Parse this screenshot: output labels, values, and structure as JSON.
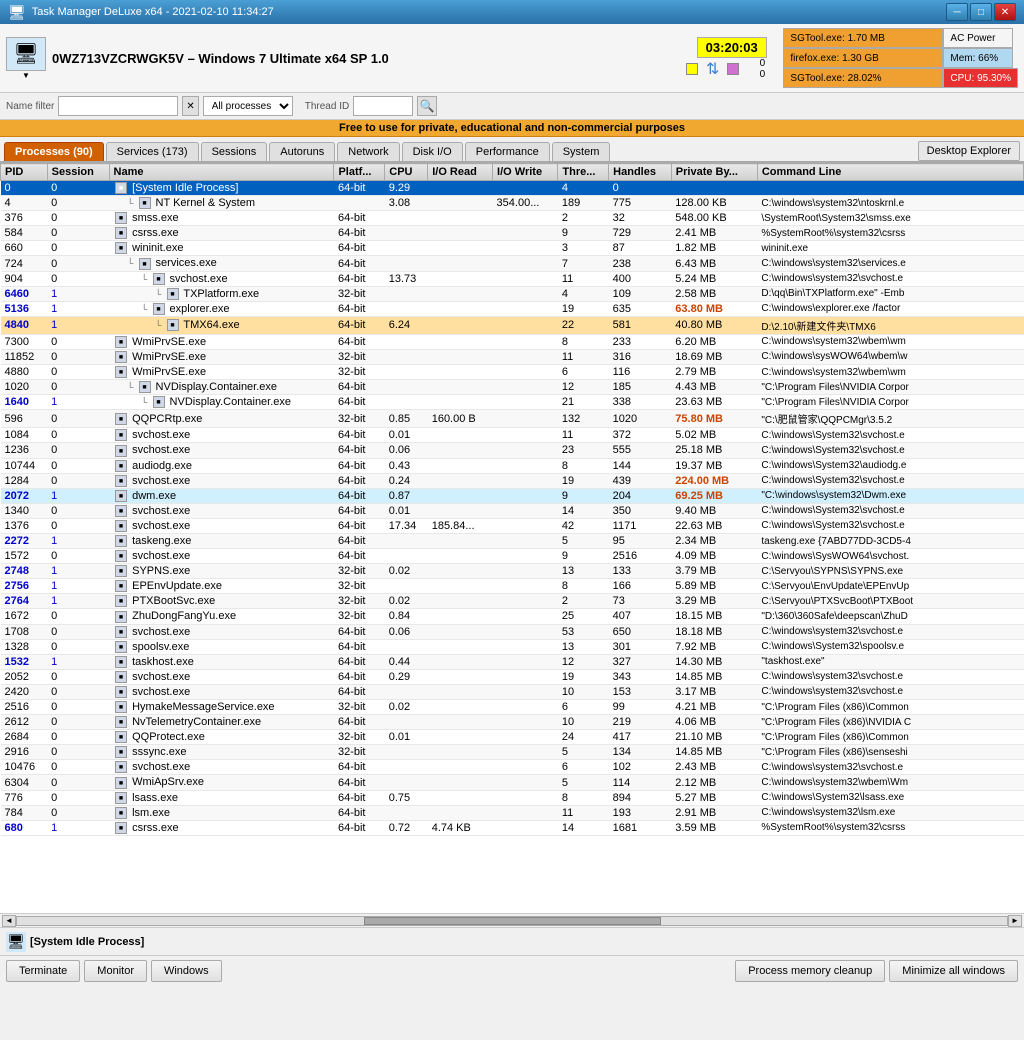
{
  "window": {
    "title": "Task Manager DeLuxe x64 - 2021-02-10 11:34:27",
    "icon": "🖥"
  },
  "header": {
    "machine_name": "0WZ713VZCRWGK5V – Windows 7 Ultimate x64 SP 1.0",
    "clock": "03:20:03",
    "ac_power": "AC Power",
    "mem_label": "Mem: 66%",
    "cpu_label": "CPU: 95.30%",
    "sgtool_mem": "SGTool.exe: 1.70 MB",
    "firefox_mem": "firefox.exe: 1.30 GB",
    "sgtool_cpu": "SGTool.exe: 28.02%"
  },
  "filterbar": {
    "name_filter_label": "Name filter",
    "name_filter_value": "",
    "process_dropdown": "All processes",
    "thread_id_label": "Thread ID",
    "thread_id_value": ""
  },
  "infobar": {
    "text": "Free to use for private, educational and non-commercial  purposes"
  },
  "tabs": {
    "items": [
      {
        "label": "Processes (90)",
        "active": true
      },
      {
        "label": "Services (173)",
        "active": false
      },
      {
        "label": "Sessions",
        "active": false
      },
      {
        "label": "Autoruns",
        "active": false
      },
      {
        "label": "Network",
        "active": false
      },
      {
        "label": "Disk I/O",
        "active": false
      },
      {
        "label": "Performance",
        "active": false
      },
      {
        "label": "System",
        "active": false
      }
    ],
    "desktop_explorer": "Desktop Explorer"
  },
  "table": {
    "columns": [
      "PID",
      "Session",
      "Name",
      "Platf...",
      "CPU",
      "I/O Read",
      "I/O Write",
      "Thre...",
      "Handles",
      "Private By...",
      "Command Line"
    ],
    "rows": [
      {
        "pid": "0",
        "session": "0",
        "name": "[System Idle Process]",
        "platform": "64-bit",
        "cpu": "9.29",
        "io_read": "",
        "io_write": "",
        "threads": "4",
        "handles": "0",
        "private_bytes": "",
        "cmdline": "",
        "indent": 0,
        "selected": true
      },
      {
        "pid": "4",
        "session": "0",
        "name": "NT Kernel & System",
        "platform": "",
        "cpu": "3.08",
        "io_read": "",
        "io_write": "354.00...",
        "threads": "189",
        "handles": "775",
        "private_bytes": "128.00 KB",
        "cmdline": "C:\\windows\\system32\\ntoskrnl.e",
        "indent": 1
      },
      {
        "pid": "376",
        "session": "0",
        "name": "smss.exe",
        "platform": "64-bit",
        "cpu": "",
        "io_read": "",
        "io_write": "",
        "threads": "2",
        "handles": "32",
        "private_bytes": "548.00 KB",
        "cmdline": "\\SystemRoot\\System32\\smss.exe",
        "indent": 0
      },
      {
        "pid": "584",
        "session": "0",
        "name": "csrss.exe",
        "platform": "64-bit",
        "cpu": "",
        "io_read": "",
        "io_write": "",
        "threads": "9",
        "handles": "729",
        "private_bytes": "2.41 MB",
        "cmdline": "%SystemRoot%\\system32\\csrss",
        "indent": 0
      },
      {
        "pid": "660",
        "session": "0",
        "name": "wininit.exe",
        "platform": "64-bit",
        "cpu": "",
        "io_read": "",
        "io_write": "",
        "threads": "3",
        "handles": "87",
        "private_bytes": "1.82 MB",
        "cmdline": "wininit.exe",
        "indent": 0
      },
      {
        "pid": "724",
        "session": "0",
        "name": "services.exe",
        "platform": "64-bit",
        "cpu": "",
        "io_read": "",
        "io_write": "",
        "threads": "7",
        "handles": "238",
        "private_bytes": "6.43 MB",
        "cmdline": "C:\\windows\\system32\\services.e",
        "indent": 1
      },
      {
        "pid": "904",
        "session": "0",
        "name": "svchost.exe",
        "platform": "64-bit",
        "cpu": "13.73",
        "io_read": "",
        "io_write": "",
        "threads": "11",
        "handles": "400",
        "private_bytes": "5.24 MB",
        "cmdline": "C:\\windows\\system32\\svchost.e",
        "indent": 2
      },
      {
        "pid": "6460",
        "session": "1",
        "name": "TXPlatform.exe",
        "platform": "32-bit",
        "cpu": "",
        "io_read": "",
        "io_write": "",
        "threads": "4",
        "handles": "109",
        "private_bytes": "2.58 MB",
        "cmdline": "D:\\qq\\Bin\\TXPlatform.exe\" -Emb",
        "indent": 3,
        "blue_pid": true
      },
      {
        "pid": "5136",
        "session": "1",
        "name": "explorer.exe",
        "platform": "64-bit",
        "cpu": "",
        "io_read": "",
        "io_write": "",
        "threads": "19",
        "handles": "635",
        "private_bytes": "63.80 MB",
        "cmdline": "C:\\windows\\explorer.exe /factor",
        "indent": 2,
        "blue_pid": true
      },
      {
        "pid": "4840",
        "session": "1",
        "name": "TMX64.exe",
        "platform": "64-bit",
        "cpu": "6.24",
        "io_read": "",
        "io_write": "",
        "threads": "22",
        "handles": "581",
        "private_bytes": "40.80 MB",
        "cmdline": "D:\\2.10\\新建文件夹\\TMX6",
        "indent": 3,
        "blue_pid": true,
        "orange": true
      },
      {
        "pid": "7300",
        "session": "0",
        "name": "WmiPrvSE.exe",
        "platform": "64-bit",
        "cpu": "",
        "io_read": "",
        "io_write": "",
        "threads": "8",
        "handles": "233",
        "private_bytes": "6.20 MB",
        "cmdline": "C:\\windows\\system32\\wbem\\wm",
        "indent": 0
      },
      {
        "pid": "11852",
        "session": "0",
        "name": "WmiPrvSE.exe",
        "platform": "32-bit",
        "cpu": "",
        "io_read": "",
        "io_write": "",
        "threads": "11",
        "handles": "316",
        "private_bytes": "18.69 MB",
        "cmdline": "C:\\windows\\sysWOW64\\wbem\\w",
        "indent": 0
      },
      {
        "pid": "4880",
        "session": "0",
        "name": "WmiPrvSE.exe",
        "platform": "32-bit",
        "cpu": "",
        "io_read": "",
        "io_write": "",
        "threads": "6",
        "handles": "116",
        "private_bytes": "2.79 MB",
        "cmdline": "C:\\windows\\system32\\wbem\\wm",
        "indent": 0
      },
      {
        "pid": "1020",
        "session": "0",
        "name": "NVDisplay.Container.exe",
        "platform": "64-bit",
        "cpu": "",
        "io_read": "",
        "io_write": "",
        "threads": "12",
        "handles": "185",
        "private_bytes": "4.43 MB",
        "cmdline": "\"C:\\Program Files\\NVIDIA Corpor",
        "indent": 1
      },
      {
        "pid": "1640",
        "session": "1",
        "name": "NVDisplay.Container.exe",
        "platform": "64-bit",
        "cpu": "",
        "io_read": "",
        "io_write": "",
        "threads": "21",
        "handles": "338",
        "private_bytes": "23.63 MB",
        "cmdline": "\"C:\\Program Files\\NVIDIA Corpor",
        "indent": 2,
        "blue_pid": true
      },
      {
        "pid": "596",
        "session": "0",
        "name": "QQPCRtp.exe",
        "platform": "32-bit",
        "cpu": "0.85",
        "io_read": "160.00 B",
        "io_write": "",
        "threads": "132",
        "handles": "1020",
        "private_bytes": "75.80 MB",
        "cmdline": "\"C:\\肥鼠管家\\QQPCMgr\\3.5.2",
        "indent": 0
      },
      {
        "pid": "1084",
        "session": "0",
        "name": "svchost.exe",
        "platform": "64-bit",
        "cpu": "0.01",
        "io_read": "",
        "io_write": "",
        "threads": "11",
        "handles": "372",
        "private_bytes": "5.02 MB",
        "cmdline": "C:\\windows\\System32\\svchost.e",
        "indent": 0
      },
      {
        "pid": "1236",
        "session": "0",
        "name": "svchost.exe",
        "platform": "64-bit",
        "cpu": "0.06",
        "io_read": "",
        "io_write": "",
        "threads": "23",
        "handles": "555",
        "private_bytes": "25.18 MB",
        "cmdline": "C:\\windows\\System32\\svchost.e",
        "indent": 0
      },
      {
        "pid": "10744",
        "session": "0",
        "name": "audiodg.exe",
        "platform": "64-bit",
        "cpu": "0.43",
        "io_read": "",
        "io_write": "",
        "threads": "8",
        "handles": "144",
        "private_bytes": "19.37 MB",
        "cmdline": "C:\\windows\\System32\\audiodg.e",
        "indent": 0
      },
      {
        "pid": "1284",
        "session": "0",
        "name": "svchost.exe",
        "platform": "64-bit",
        "cpu": "0.24",
        "io_read": "",
        "io_write": "",
        "threads": "19",
        "handles": "439",
        "private_bytes": "224.00 MB",
        "cmdline": "C:\\windows\\System32\\svchost.e",
        "indent": 0
      },
      {
        "pid": "2072",
        "session": "1",
        "name": "dwm.exe",
        "platform": "64-bit",
        "cpu": "0.87",
        "io_read": "",
        "io_write": "",
        "threads": "9",
        "handles": "204",
        "private_bytes": "69.25 MB",
        "cmdline": "\"C:\\windows\\system32\\Dwm.exe",
        "indent": 0,
        "blue_pid": true,
        "cyan": true
      },
      {
        "pid": "1340",
        "session": "0",
        "name": "svchost.exe",
        "platform": "64-bit",
        "cpu": "0.01",
        "io_read": "",
        "io_write": "",
        "threads": "14",
        "handles": "350",
        "private_bytes": "9.40 MB",
        "cmdline": "C:\\windows\\System32\\svchost.e",
        "indent": 0
      },
      {
        "pid": "1376",
        "session": "0",
        "name": "svchost.exe",
        "platform": "64-bit",
        "cpu": "17.34",
        "io_read": "185.84...",
        "io_write": "",
        "threads": "42",
        "handles": "1171",
        "private_bytes": "22.63 MB",
        "cmdline": "C:\\windows\\System32\\svchost.e",
        "indent": 0
      },
      {
        "pid": "2272",
        "session": "1",
        "name": "taskeng.exe",
        "platform": "64-bit",
        "cpu": "",
        "io_read": "",
        "io_write": "",
        "threads": "5",
        "handles": "95",
        "private_bytes": "2.34 MB",
        "cmdline": "taskeng.exe {7ABD77DD-3CD5-4",
        "indent": 0,
        "blue_pid": true
      },
      {
        "pid": "1572",
        "session": "0",
        "name": "svchost.exe",
        "platform": "64-bit",
        "cpu": "",
        "io_read": "",
        "io_write": "",
        "threads": "9",
        "handles": "2516",
        "private_bytes": "4.09 MB",
        "cmdline": "C:\\windows\\SysWOW64\\svchost.",
        "indent": 0
      },
      {
        "pid": "2748",
        "session": "1",
        "name": "SYPNS.exe",
        "platform": "32-bit",
        "cpu": "0.02",
        "io_read": "",
        "io_write": "",
        "threads": "13",
        "handles": "133",
        "private_bytes": "3.79 MB",
        "cmdline": "C:\\Servyou\\SYPNS\\SYPNS.exe",
        "indent": 0,
        "blue_pid": true
      },
      {
        "pid": "2756",
        "session": "1",
        "name": "EPEnvUpdate.exe",
        "platform": "32-bit",
        "cpu": "",
        "io_read": "",
        "io_write": "",
        "threads": "8",
        "handles": "166",
        "private_bytes": "5.89 MB",
        "cmdline": "C:\\Servyou\\EnvUpdate\\EPEnvUp",
        "indent": 0,
        "blue_pid": true
      },
      {
        "pid": "2764",
        "session": "1",
        "name": "PTXBootSvc.exe",
        "platform": "32-bit",
        "cpu": "0.02",
        "io_read": "",
        "io_write": "",
        "threads": "2",
        "handles": "73",
        "private_bytes": "3.29 MB",
        "cmdline": "C:\\Servyou\\PTXSvcBoot\\PTXBoot",
        "indent": 0,
        "blue_pid": true
      },
      {
        "pid": "1672",
        "session": "0",
        "name": "ZhuDongFangYu.exe",
        "platform": "32-bit",
        "cpu": "0.84",
        "io_read": "",
        "io_write": "",
        "threads": "25",
        "handles": "407",
        "private_bytes": "18.15 MB",
        "cmdline": "\"D:\\360\\360Safe\\deepscan\\ZhuD",
        "indent": 0
      },
      {
        "pid": "1708",
        "session": "0",
        "name": "svchost.exe",
        "platform": "64-bit",
        "cpu": "0.06",
        "io_read": "",
        "io_write": "",
        "threads": "53",
        "handles": "650",
        "private_bytes": "18.18 MB",
        "cmdline": "C:\\windows\\system32\\svchost.e",
        "indent": 0
      },
      {
        "pid": "1328",
        "session": "0",
        "name": "spoolsv.exe",
        "platform": "64-bit",
        "cpu": "",
        "io_read": "",
        "io_write": "",
        "threads": "13",
        "handles": "301",
        "private_bytes": "7.92 MB",
        "cmdline": "C:\\windows\\System32\\spoolsv.e",
        "indent": 0
      },
      {
        "pid": "1532",
        "session": "1",
        "name": "taskhost.exe",
        "platform": "64-bit",
        "cpu": "0.44",
        "io_read": "",
        "io_write": "",
        "threads": "12",
        "handles": "327",
        "private_bytes": "14.30 MB",
        "cmdline": "\"taskhost.exe\"",
        "indent": 0,
        "blue_pid": true
      },
      {
        "pid": "2052",
        "session": "0",
        "name": "svchost.exe",
        "platform": "64-bit",
        "cpu": "0.29",
        "io_read": "",
        "io_write": "",
        "threads": "19",
        "handles": "343",
        "private_bytes": "14.85 MB",
        "cmdline": "C:\\windows\\system32\\svchost.e",
        "indent": 0
      },
      {
        "pid": "2420",
        "session": "0",
        "name": "svchost.exe",
        "platform": "64-bit",
        "cpu": "",
        "io_read": "",
        "io_write": "",
        "threads": "10",
        "handles": "153",
        "private_bytes": "3.17 MB",
        "cmdline": "C:\\windows\\system32\\svchost.e",
        "indent": 0
      },
      {
        "pid": "2516",
        "session": "0",
        "name": "HymakeMessageService.exe",
        "platform": "32-bit",
        "cpu": "0.02",
        "io_read": "",
        "io_write": "",
        "threads": "6",
        "handles": "99",
        "private_bytes": "4.21 MB",
        "cmdline": "\"C:\\Program Files (x86)\\Common",
        "indent": 0
      },
      {
        "pid": "2612",
        "session": "0",
        "name": "NvTelemetryContainer.exe",
        "platform": "64-bit",
        "cpu": "",
        "io_read": "",
        "io_write": "",
        "threads": "10",
        "handles": "219",
        "private_bytes": "4.06 MB",
        "cmdline": "\"C:\\Program Files (x86)\\NVIDIA C",
        "indent": 0
      },
      {
        "pid": "2684",
        "session": "0",
        "name": "QQProtect.exe",
        "platform": "32-bit",
        "cpu": "0.01",
        "io_read": "",
        "io_write": "",
        "threads": "24",
        "handles": "417",
        "private_bytes": "21.10 MB",
        "cmdline": "\"C:\\Program Files (x86)\\Common",
        "indent": 0
      },
      {
        "pid": "2916",
        "session": "0",
        "name": "sssync.exe",
        "platform": "32-bit",
        "cpu": "",
        "io_read": "",
        "io_write": "",
        "threads": "5",
        "handles": "134",
        "private_bytes": "14.85 MB",
        "cmdline": "\"C:\\Program Files (x86)\\senseshi",
        "indent": 0
      },
      {
        "pid": "10476",
        "session": "0",
        "name": "svchost.exe",
        "platform": "64-bit",
        "cpu": "",
        "io_read": "",
        "io_write": "",
        "threads": "6",
        "handles": "102",
        "private_bytes": "2.43 MB",
        "cmdline": "C:\\windows\\system32\\svchost.e",
        "indent": 0
      },
      {
        "pid": "6304",
        "session": "0",
        "name": "WmiApSrv.exe",
        "platform": "64-bit",
        "cpu": "",
        "io_read": "",
        "io_write": "",
        "threads": "5",
        "handles": "114",
        "private_bytes": "2.12 MB",
        "cmdline": "C:\\windows\\system32\\wbem\\Wm",
        "indent": 0
      },
      {
        "pid": "776",
        "session": "0",
        "name": "lsass.exe",
        "platform": "64-bit",
        "cpu": "0.75",
        "io_read": "",
        "io_write": "",
        "threads": "8",
        "handles": "894",
        "private_bytes": "5.27 MB",
        "cmdline": "C:\\windows\\System32\\lsass.exe",
        "indent": 0
      },
      {
        "pid": "784",
        "session": "0",
        "name": "lsm.exe",
        "platform": "64-bit",
        "cpu": "",
        "io_read": "",
        "io_write": "",
        "threads": "11",
        "handles": "193",
        "private_bytes": "2.91 MB",
        "cmdline": "C:\\windows\\system32\\lsm.exe",
        "indent": 0
      },
      {
        "pid": "680",
        "session": "1",
        "name": "csrss.exe",
        "platform": "64-bit",
        "cpu": "0.72",
        "io_read": "4.74 KB",
        "io_write": "",
        "threads": "14",
        "handles": "1681",
        "private_bytes": "3.59 MB",
        "cmdline": "%SystemRoot%\\system32\\csrss",
        "indent": 0,
        "blue_pid": true
      }
    ]
  },
  "statusbar": {
    "selected_process": "[System Idle Process]"
  },
  "buttons": {
    "terminate": "Terminate",
    "monitor": "Monitor",
    "windows": "Windows",
    "memory_cleanup": "Process memory cleanup",
    "minimize_all": "Minimize all windows"
  }
}
